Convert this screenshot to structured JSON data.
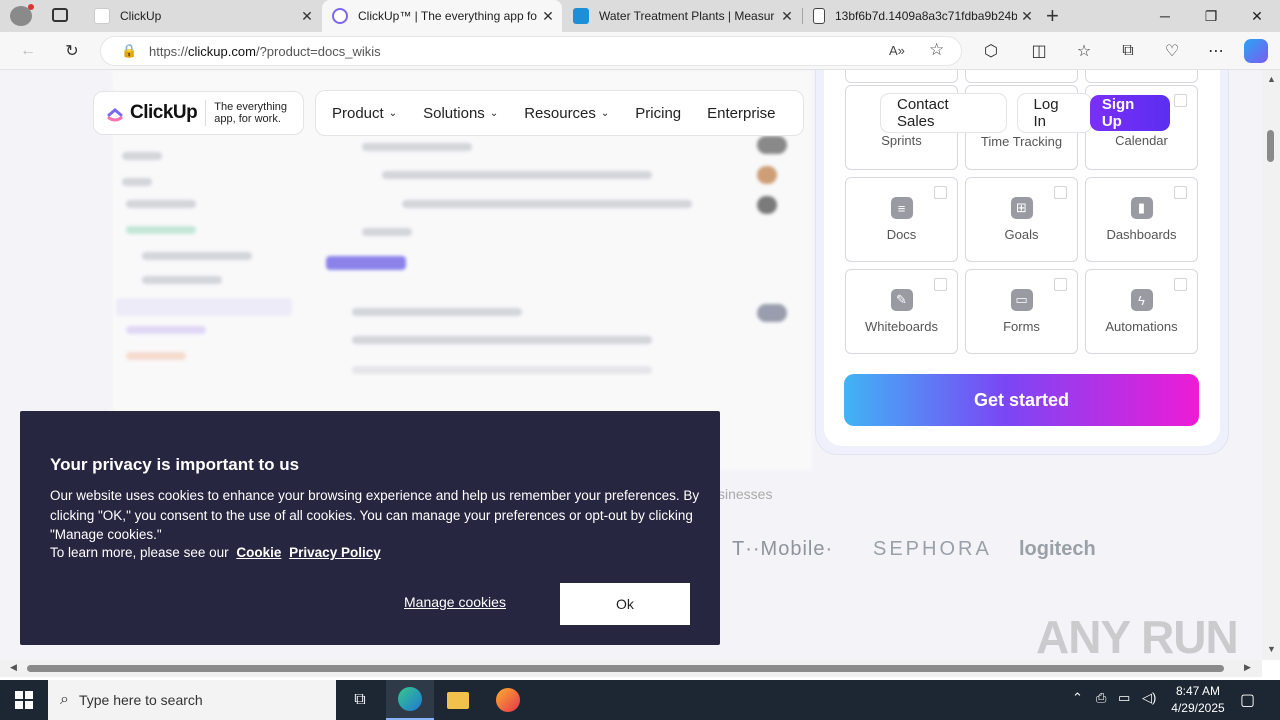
{
  "browser": {
    "tabs": [
      {
        "title": "ClickUp",
        "active": false
      },
      {
        "title": "ClickUp™ | The everything app fo",
        "active": true
      },
      {
        "title": "Water Treatment Plants | Measur",
        "active": false
      },
      {
        "title": "13bf6b7d.1409a8a3c71fdba9b24b",
        "active": false
      }
    ],
    "new_tab_label": "+",
    "url_prefix": "https://",
    "url_host": "clickup.com",
    "url_path": "/?product=docs_wikis"
  },
  "site": {
    "logo_text": "ClickUp",
    "logo_tagline": "The everything app, for work.",
    "nav": [
      {
        "label": "Product",
        "dropdown": true
      },
      {
        "label": "Solutions",
        "dropdown": true
      },
      {
        "label": "Resources",
        "dropdown": true
      },
      {
        "label": "Pricing",
        "dropdown": false
      },
      {
        "label": "Enterprise",
        "dropdown": false
      }
    ],
    "contact_sales": "Contact Sales",
    "login": "Log In",
    "signup": "Sign Up"
  },
  "features": {
    "rows": [
      [
        {
          "label": "Sprints",
          "icon": "sprint-icon"
        },
        {
          "label": "Time Tracking",
          "icon": "clock-icon"
        },
        {
          "label": "Calendar",
          "icon": "calendar-icon"
        }
      ],
      [
        {
          "label": "Docs",
          "icon": "doc-icon"
        },
        {
          "label": "Goals",
          "icon": "goals-icon"
        },
        {
          "label": "Dashboards",
          "icon": "dashboard-icon"
        }
      ],
      [
        {
          "label": "Whiteboards",
          "icon": "whiteboard-icon"
        },
        {
          "label": "Forms",
          "icon": "form-icon"
        },
        {
          "label": "Automations",
          "icon": "automation-icon"
        }
      ]
    ],
    "cta": "Get started"
  },
  "trust": {
    "text": "sinesses",
    "brands": [
      "T··Mobile·",
      "SEPHORA",
      "logitech"
    ]
  },
  "cookie": {
    "title": "Your privacy is important to us",
    "body": "Our website uses cookies to enhance your browsing experience and help us remember your preferences. By clicking \"OK,\" you consent to the use of all cookies. You can manage your preferences or opt-out by clicking \"Manage cookies.\"",
    "learn_more": "To learn more, please see our",
    "cookie_link": "Cookie",
    "privacy_link": "Privacy Policy",
    "manage": "Manage cookies",
    "ok": "Ok"
  },
  "watermark": "ANY RUN",
  "taskbar": {
    "search_placeholder": "Type here to search",
    "time": "8:47 AM",
    "date": "4/29/2025"
  }
}
